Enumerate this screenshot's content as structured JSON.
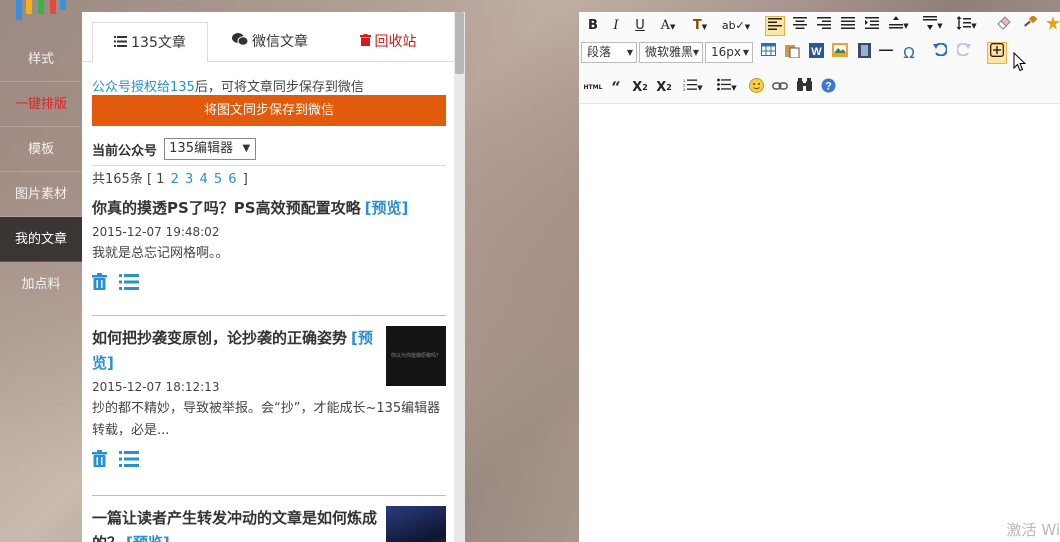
{
  "nav": {
    "items": [
      {
        "label": "样式"
      },
      {
        "label": "一键排版"
      },
      {
        "label": "模板"
      },
      {
        "label": "图片素材"
      },
      {
        "label": "我的文章"
      },
      {
        "label": "加点料"
      }
    ]
  },
  "panel": {
    "tabs": [
      {
        "label": "135文章"
      },
      {
        "label": "微信文章"
      },
      {
        "label": "回收站"
      }
    ],
    "auth_link": "公众号授权给135",
    "auth_text": "后，可将文章同步保存到微信",
    "save_button": "将图文同步保存到微信",
    "account_label": "当前公众号",
    "account_value": "135编辑器",
    "pager_prefix": "共165条 [",
    "pager_current": "1",
    "pages": [
      "2",
      "3",
      "4",
      "5",
      "6"
    ],
    "pager_suffix": "]",
    "preview_label": "[预览]",
    "articles": [
      {
        "title": "你真的摸透PS了吗？PS高效预配置攻略",
        "date": "2015-12-07 19:48:02",
        "summary": "我就是总忘记网格啊。。"
      },
      {
        "title": "如何把抄袭变原创，论抄袭的正确姿势",
        "date": "2015-12-07 18:12:13",
        "summary": "抄的都不精妙，导致被举报。会“抄”，才能成长~135编辑器转载，必是...",
        "thumb_caption": "你以为你能做原稿吗？"
      },
      {
        "title": "一篇让读者产生转发冲动的文章是如何炼成的？"
      }
    ]
  },
  "editor": {
    "paragraph_select": "段落",
    "font_select": "微软雅黑",
    "size_select": "16px",
    "watermark": "激活 Wi"
  },
  "colors": {
    "accent_orange": "#e25a0c",
    "link_blue": "#2a8fd3",
    "danger_red": "#d41a1a"
  }
}
